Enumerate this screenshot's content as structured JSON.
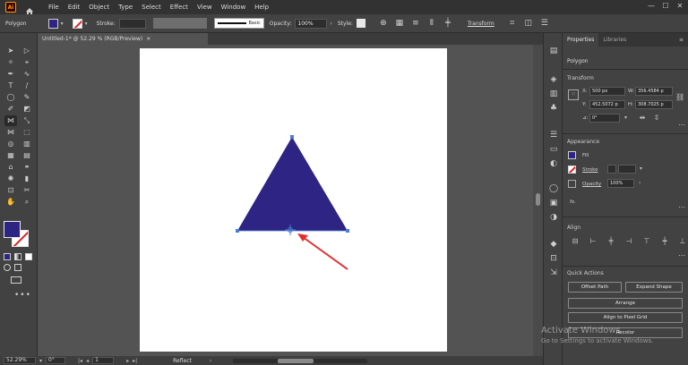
{
  "app": {
    "logo": "Ai"
  },
  "menu": [
    "File",
    "Edit",
    "Object",
    "Type",
    "Select",
    "Effect",
    "View",
    "Window",
    "Help"
  ],
  "window_controls": [
    "—",
    "☐",
    "✕"
  ],
  "control_bar": {
    "object_label": "Polygon",
    "stroke_label": "Stroke:",
    "stroke_profile": "Basic",
    "opacity_label": "Opacity:",
    "opacity_value": "100%",
    "style_label": "Style:",
    "transform_label": "Transform"
  },
  "document_tab": {
    "title": "Untitled-1* @ 52.29 % (RGB/Preview)",
    "close": "×"
  },
  "status_bar": {
    "zoom": "52.29%",
    "rotation": "0°",
    "artboard": "1",
    "tool": "Reflect"
  },
  "panel": {
    "tabs": [
      "Properties",
      "Libraries"
    ],
    "object_type": "Polygon",
    "transform": {
      "title": "Transform",
      "x_label": "X:",
      "x": "500 px",
      "y_label": "Y:",
      "y": "452.5072 p",
      "w_label": "W:",
      "w": "356.4584 p",
      "h_label": "H:",
      "h": "308.7025 p",
      "angle_label": "⊿:",
      "angle": "0°"
    },
    "appearance": {
      "title": "Appearance",
      "fill_label": "Fill",
      "stroke_label": "Stroke",
      "opacity_label": "Opacity",
      "opacity_value": "100%",
      "fx_label": "fx."
    },
    "align": {
      "title": "Align"
    },
    "quick_actions": {
      "title": "Quick Actions",
      "offset_path": "Offset Path",
      "expand_shape": "Expand Shape",
      "arrange": "Arrange",
      "align_pixel_grid": "Align to Pixel Grid",
      "recolor": "Recolor"
    }
  },
  "watermark": {
    "title": "Activate Windows",
    "subtitle": "Go to Settings to activate Windows."
  },
  "colors": {
    "fill": "#2e2483",
    "stroke": "#e02020",
    "arrow": "#e03030",
    "selection": "#4a7fd4"
  }
}
